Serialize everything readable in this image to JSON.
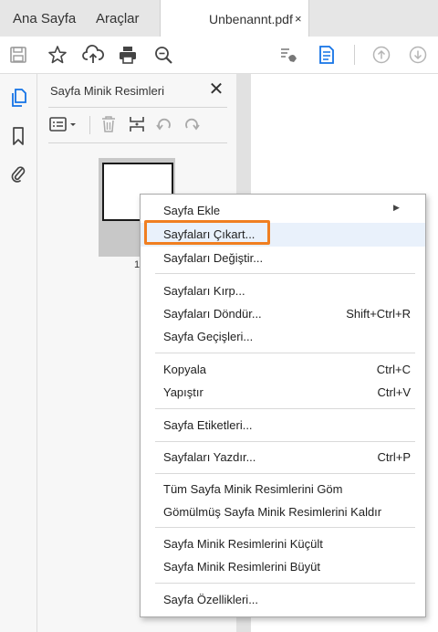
{
  "tabs": {
    "home": "Ana Sayfa",
    "tools": "Araçlar",
    "document": "Unbenannt.pdf",
    "close": "×"
  },
  "toolbar": {
    "icons": [
      "save-icon",
      "bookmark-star-icon",
      "cloud-upload-icon",
      "print-icon",
      "zoom-icon",
      "sign-icon",
      "page-thumbnail-icon",
      "page-up-icon",
      "page-down-icon"
    ]
  },
  "panel": {
    "title": "Sayfa Minik Resimleri",
    "close": "✕",
    "page_number": "1"
  },
  "context_menu": {
    "items": [
      {
        "label": "Sayfa Ekle",
        "shortcut": "",
        "submenu": true
      },
      {
        "label": "Sayfaları Çıkart...",
        "shortcut": "",
        "highlighted": true
      },
      {
        "label": "Sayfaları Değiştir...",
        "shortcut": ""
      },
      {
        "label": "Sayfaları Kırp...",
        "shortcut": ""
      },
      {
        "label": "Sayfaları Döndür...",
        "shortcut": "Shift+Ctrl+R"
      },
      {
        "label": "Sayfa Geçişleri...",
        "shortcut": ""
      },
      {
        "label": "Kopyala",
        "shortcut": "Ctrl+C"
      },
      {
        "label": "Yapıştır",
        "shortcut": "Ctrl+V"
      },
      {
        "label": "Sayfa Etiketleri...",
        "shortcut": ""
      },
      {
        "label": "Sayfaları Yazdır...",
        "shortcut": "Ctrl+P"
      },
      {
        "label": "Tüm Sayfa Minik Resimlerini Göm",
        "shortcut": ""
      },
      {
        "label": "Gömülmüş Sayfa Minik Resimlerini Kaldır",
        "shortcut": ""
      },
      {
        "label": "Sayfa Minik Resimlerini Küçült",
        "shortcut": ""
      },
      {
        "label": "Sayfa Minik Resimlerini Büyüt",
        "shortcut": ""
      },
      {
        "label": "Sayfa Özellikleri...",
        "shortcut": ""
      }
    ]
  },
  "colors": {
    "accent_blue": "#1473e6",
    "highlight_outline": "#f07f21",
    "icon_gray": "#555555"
  }
}
